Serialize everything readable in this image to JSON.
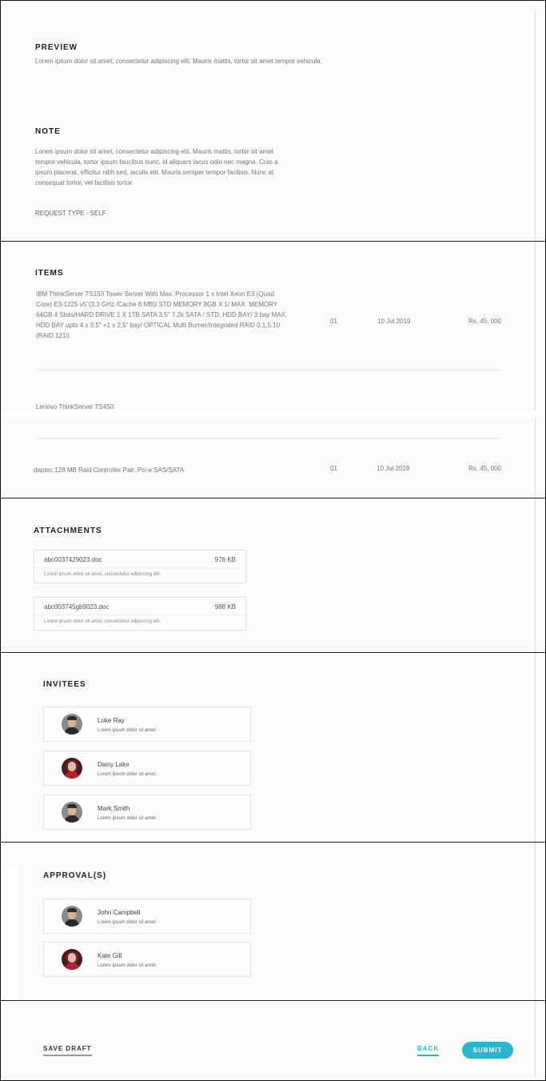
{
  "preview": {
    "title": "PREVIEW",
    "text": "Lorem ipsum dolor sit amet, consectetur adipiscing elit. Mauris mattis, tortor sit amet tempor vehicula."
  },
  "note": {
    "title": "NOTE",
    "text": "Lorem ipsum dolor sit amet, consectetur adipiscing elit. Mauris mattis, tortor sit amet tempor vehicula, tortor ipsum faucibus nunc, id aliquam lacus odio nec magna. Cras a ipsum placerat, efficitur nibh sed, iaculis elit. Mauris semper tempor facilisis. Nunc at consequat tortor, vel facilisis tortor.",
    "request_type": "REQUEST TYPE  - SELF"
  },
  "items": {
    "title": "ITEMS",
    "rows": [
      {
        "description": "IBM ThinkServer TS150 Tower Server With Max. Processor 1 x Intel Xeon E3 (Quad Core) E3-1225 v5\"(3.3 GHz /Cache 8 MB)/ STD MEMORY 8GB X 1/ MAX. MEMORY 64GB 4 Slots/HARD DRIVE 1 X 1TB SATA 3.5\" 7.2k SATA / STD. HDD BAY/ 3 bay MAX. HDD BAY upto 4 x 3.5\" +1 x 2.5\" bay/ OPTICAL Multi Burner/Integrated RAID 0,1,5,10 (RAID 121i).",
        "qty": "01",
        "date": "10 Jul 2019",
        "amount": "Rs. 45, 000"
      },
      {
        "description": "Lenovo ThinkServer TS450",
        "qty": "",
        "date": "",
        "amount": ""
      },
      {
        "description": "daptec 128 MB Raid Controller Pair. Pci-e SAS/SATA",
        "qty": "01",
        "date": "10 Jul 2019",
        "amount": "Rs. 45, 000"
      }
    ]
  },
  "attachments": {
    "title": "ATTACHMENTS",
    "files": [
      {
        "name": "abc0037429023.doc",
        "size": "976 KB",
        "desc": "Lorem ipsum dolor sit amet, consectetur adipiscing elit."
      },
      {
        "name": "abc003745gb9023.doc",
        "size": "988 KB",
        "desc": "Lorem ipsum dolor sit amet, consectetur adipiscing elit."
      }
    ]
  },
  "invitees": {
    "title": "INVITEES",
    "people": [
      {
        "name": "Luke Ray",
        "desc": "Lorem ipsum doler sit amet."
      },
      {
        "name": "Daisy Lake",
        "desc": "Lorem ipsum doler sit amet."
      },
      {
        "name": "Mark Smith",
        "desc": "Lorem ipsum doler sit amet."
      }
    ]
  },
  "approvals": {
    "title": "APPROVAL(S)",
    "people": [
      {
        "name": "John Campbell",
        "desc": "Lorem ipsum doler sit amet."
      },
      {
        "name": "Kate Gill",
        "desc": "Lorem ipsum doler sit amet."
      }
    ]
  },
  "actions": {
    "save_draft": "SAVE DRAFT",
    "back": "BACK",
    "submit": "SUBMIT"
  },
  "colors": {
    "accent": "#2bb6d0"
  }
}
